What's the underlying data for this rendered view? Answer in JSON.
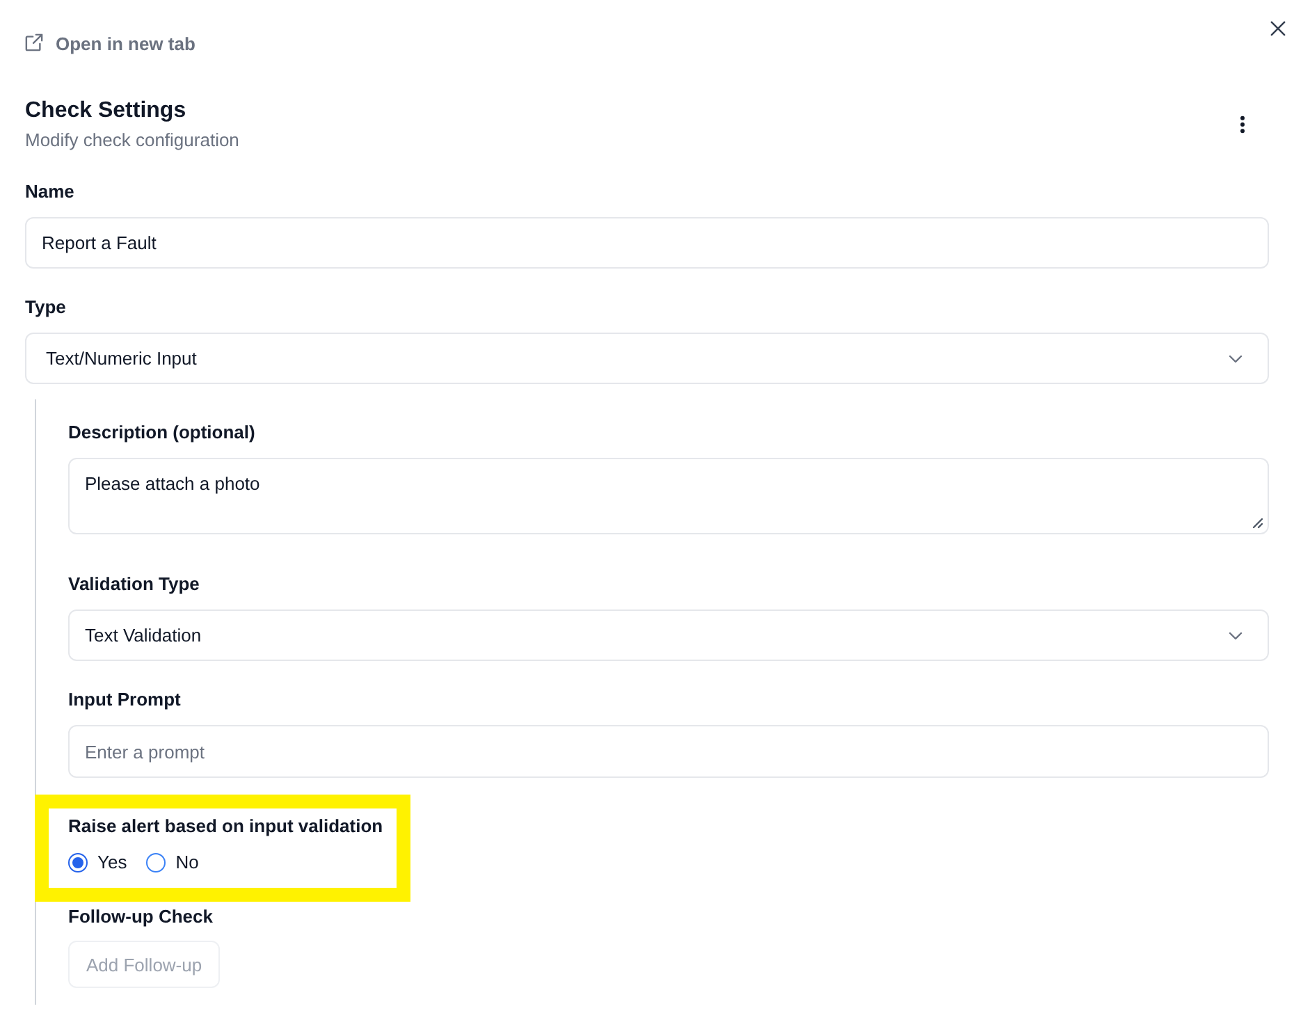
{
  "link": {
    "label": "Open in new tab"
  },
  "header": {
    "title": "Check Settings",
    "subtitle": "Modify check configuration"
  },
  "fields": [
    {
      "kind": "input",
      "label": "Name",
      "value": "Report a Fault"
    },
    {
      "kind": "select",
      "label": "Type",
      "value": "Text/Numeric Input"
    }
  ],
  "details": {
    "fields": [
      {
        "kind": "textarea",
        "label": "Description (optional)",
        "value": "Please attach a photo"
      },
      {
        "kind": "select",
        "label": "Validation Type",
        "value": "Text Validation"
      },
      {
        "kind": "input",
        "label": "Input Prompt",
        "placeholder": "Enter a prompt"
      }
    ],
    "alert": {
      "label": "Raise alert based on input validation",
      "highlighted": true,
      "options": [
        {
          "label": "Yes",
          "selected": true
        },
        {
          "label": "No",
          "selected": false
        }
      ]
    },
    "follow_up": {
      "label": "Follow-up Check",
      "button": "Add Follow-up",
      "disabled": true
    }
  }
}
